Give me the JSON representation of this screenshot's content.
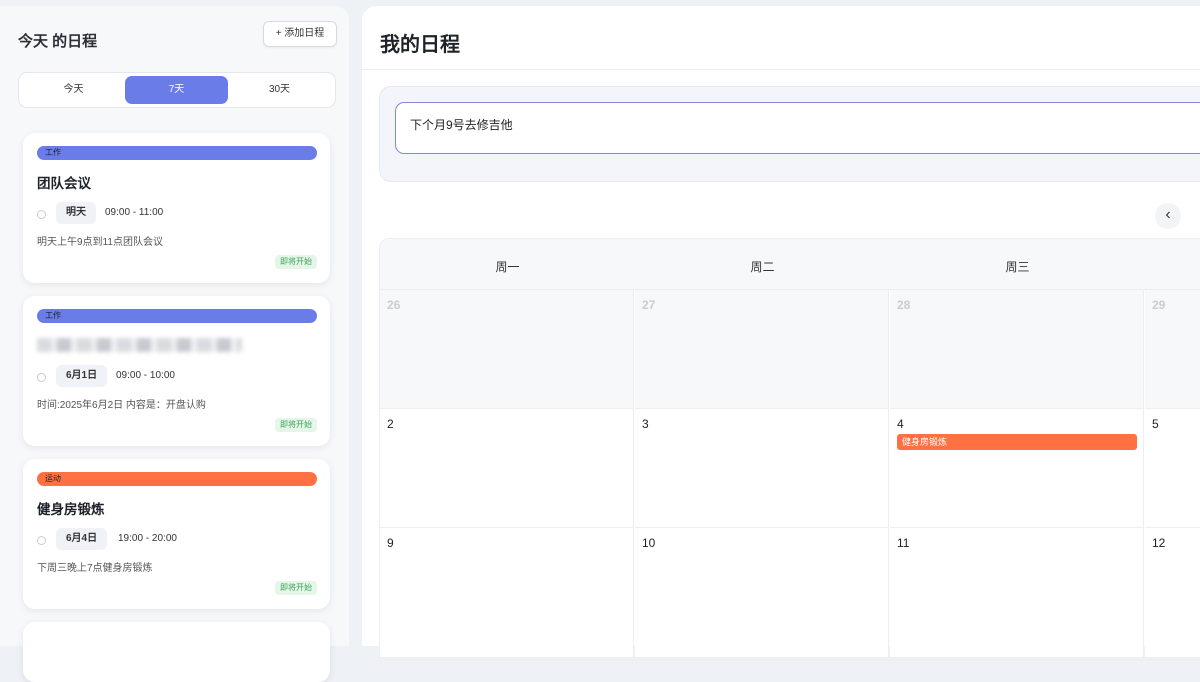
{
  "sidebar": {
    "title": "今天 的日程",
    "add_button": "+ 添加日程",
    "range_tabs": [
      "今天",
      "7天",
      "30天"
    ],
    "active_tab": "7天",
    "events": [
      {
        "tag": "工作",
        "tag_color": "#6a7ce8",
        "title": "团队会议",
        "date": "明天",
        "time": "09:00 - 11:00",
        "desc": "明天上午9点到11点团队会议",
        "status": "即将开始"
      },
      {
        "tag": "工作",
        "tag_color": "#6a7ce8",
        "title": "",
        "date": "6月1日",
        "time": "09:00 - 10:00",
        "desc": "时间:2025年6月2日 内容是：开盘认购",
        "status": "即将开始"
      },
      {
        "tag": "运动",
        "tag_color": "#ff7043",
        "title": "健身房锻炼",
        "date": "6月4日",
        "time": "19:00 - 20:00",
        "desc": "下周三晚上7点健身房锻炼",
        "status": "即将开始"
      }
    ]
  },
  "main": {
    "title": "我的日程",
    "input_value": "下个月9号去修吉他",
    "prev_label": "‹",
    "weekdays": [
      "周一",
      "周二",
      "周三",
      ""
    ],
    "weeks": [
      [
        "26",
        "27",
        "28",
        "29"
      ],
      [
        "2",
        "3",
        "4",
        "5"
      ],
      [
        "9",
        "10",
        "11",
        "12"
      ]
    ],
    "calendar_event": {
      "label": "健身房锻炼",
      "color": "#ff7043"
    }
  }
}
